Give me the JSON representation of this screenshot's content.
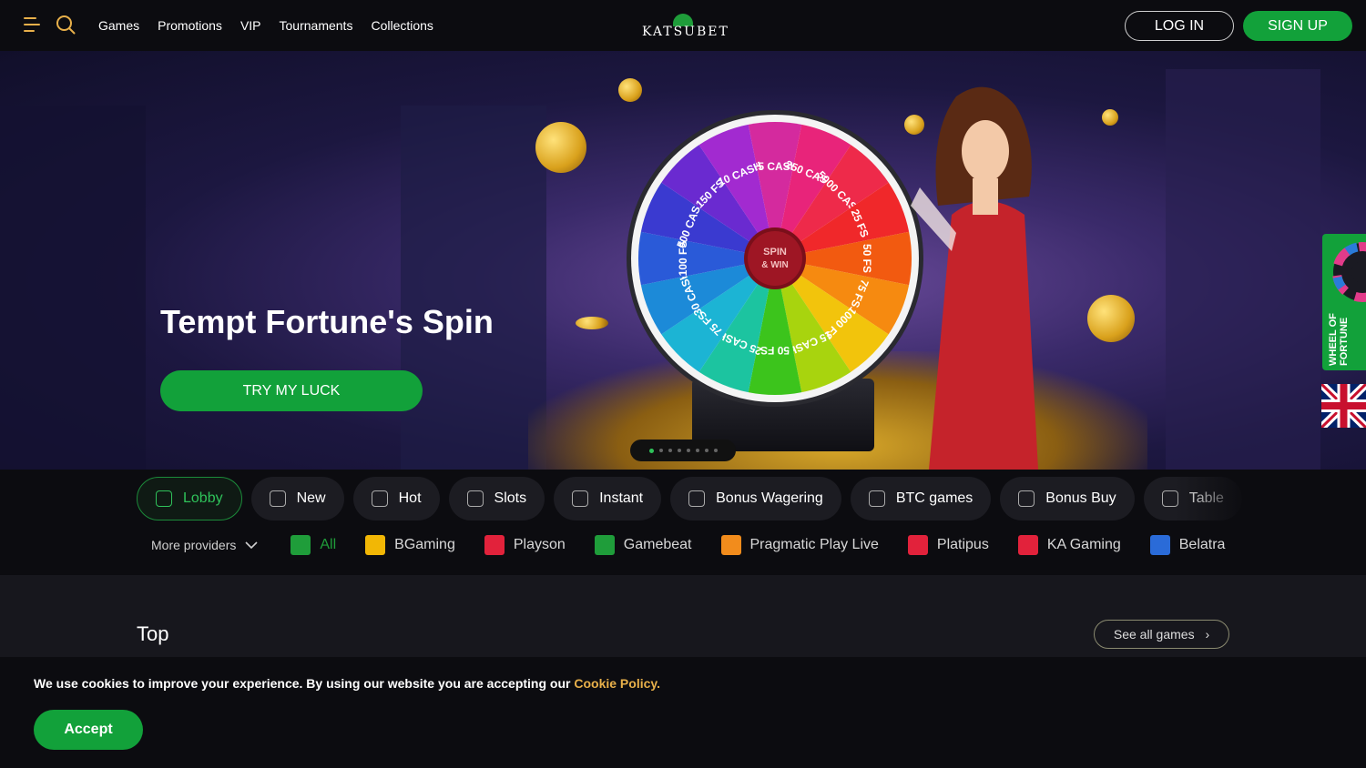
{
  "header": {
    "nav": [
      "Games",
      "Promotions",
      "VIP",
      "Tournaments",
      "Collections"
    ],
    "logo_text": "KATSUBET",
    "login_label": "LOG IN",
    "signup_label": "SIGN UP"
  },
  "hero": {
    "title": "Tempt Fortune's Spin",
    "cta_label": "TRY MY LUCK",
    "wheel_center": "SPIN & WIN",
    "wheel_segments": [
      "25 CASH",
      "250 CASH",
      "5000 CASH",
      "25 FS",
      "50 FS",
      "75 FS",
      "1000 FS",
      "15 CASH",
      "50 FS",
      "25 CASH",
      "75 FS",
      "30 CASH",
      "100 FS",
      "500 CASH",
      "150 FS",
      "10 CASH"
    ],
    "slide_count": 8,
    "active_slide": 1
  },
  "side": {
    "wheel_label": "WHEEL OF FORTUNE",
    "language_flag": "uk-flag-icon"
  },
  "categories": [
    {
      "label": "Lobby",
      "icon": "lobby-icon",
      "active": true
    },
    {
      "label": "New",
      "icon": "new-icon",
      "active": false
    },
    {
      "label": "Hot",
      "icon": "flame-icon",
      "active": false
    },
    {
      "label": "Slots",
      "icon": "cherry-icon",
      "active": false
    },
    {
      "label": "Instant",
      "icon": "instant-icon",
      "active": false
    },
    {
      "label": "Bonus Wagering",
      "icon": "wager-icon",
      "active": false
    },
    {
      "label": "BTC games",
      "icon": "bitcoin-icon",
      "active": false
    },
    {
      "label": "Bonus Buy",
      "icon": "gift-icon",
      "active": false
    },
    {
      "label": "Table",
      "icon": "table-icon",
      "active": false
    }
  ],
  "providers": {
    "more_label": "More providers",
    "items": [
      {
        "label": "All",
        "color": "#1f9d3a"
      },
      {
        "label": "BGaming",
        "color": "#f2b705"
      },
      {
        "label": "Playson",
        "color": "#e2223b"
      },
      {
        "label": "Gamebeat",
        "color": "#1f9d3a"
      },
      {
        "label": "Pragmatic Play Live",
        "color": "#f28c1c"
      },
      {
        "label": "Platipus",
        "color": "#e2223b"
      },
      {
        "label": "KA Gaming",
        "color": "#e2223b"
      },
      {
        "label": "Belatra",
        "color": "#2a6bd8"
      }
    ]
  },
  "section": {
    "title": "Top",
    "see_all_label": "See all games"
  },
  "cookie": {
    "text": "We use cookies to improve your experience. By using our website you are accepting our ",
    "link": "Cookie Policy.",
    "accept_label": "Accept"
  }
}
